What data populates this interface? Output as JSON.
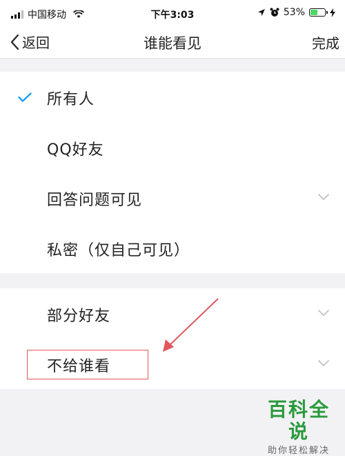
{
  "status_bar": {
    "carrier": "中国移动",
    "time": "下午3:03",
    "battery_percent": "53%",
    "battery_level": 0.53,
    "icons": [
      "signal-icon",
      "wifi-icon",
      "location-icon",
      "alarm-icon",
      "battery-icon",
      "charging-icon"
    ]
  },
  "nav": {
    "back_label": "返回",
    "title": "谁能看见",
    "done_label": "完成"
  },
  "options_group1": [
    {
      "label": "所有人",
      "selected": true,
      "expandable": false
    },
    {
      "label": "QQ好友",
      "selected": false,
      "expandable": false
    },
    {
      "label": "回答问题可见",
      "selected": false,
      "expandable": true
    },
    {
      "label": "私密（仅自己可见）",
      "selected": false,
      "expandable": false
    }
  ],
  "options_group2": [
    {
      "label": "部分好友",
      "selected": false,
      "expandable": true
    },
    {
      "label": "不给谁看",
      "selected": false,
      "expandable": true
    }
  ],
  "annotation": {
    "color": "#e0585a",
    "highlighted_option": "不给谁看"
  },
  "watermark": {
    "title": "百科全说",
    "subtitle": "助你轻松解决"
  },
  "colors": {
    "check": "#1aa0f0",
    "chevron": "#c8c8cc",
    "watermark_green": "#2a9a3c",
    "battery_green": "#4cd964"
  }
}
